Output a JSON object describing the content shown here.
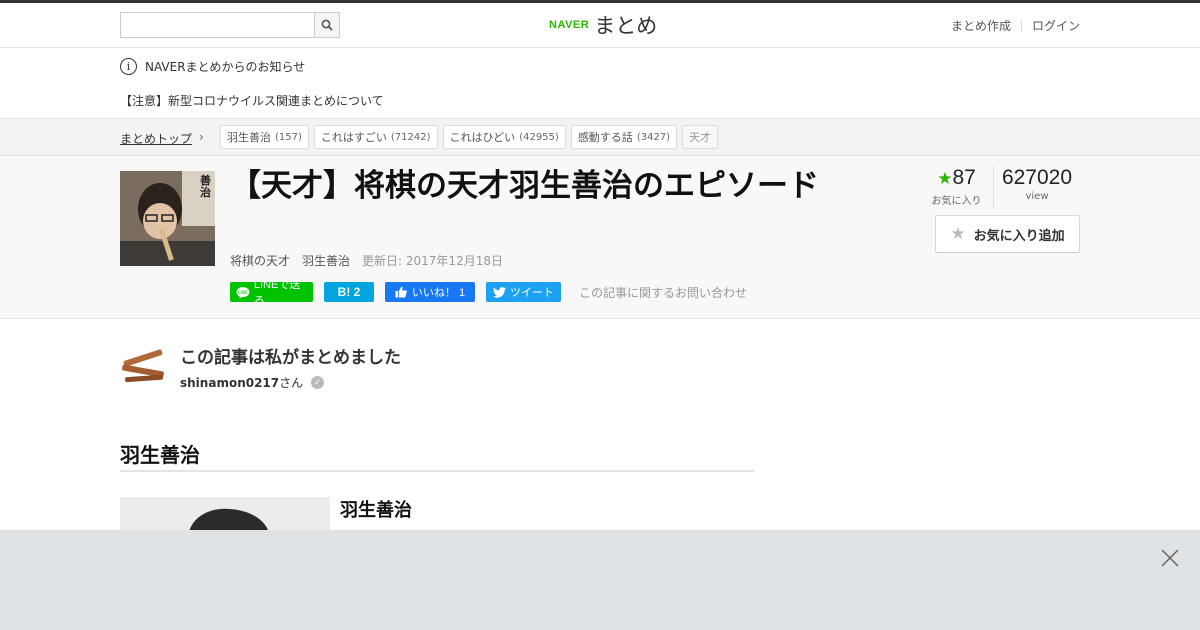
{
  "header": {
    "search_placeholder": "",
    "logo_brand": "NAVER",
    "logo_title": "まとめ",
    "links": [
      "まとめ作成",
      "ログイン"
    ]
  },
  "notice": {
    "title": "NAVERまとめからのお知らせ",
    "link": "【注意】新型コロナウイルス関連まとめについて"
  },
  "breadcrumb": {
    "top": "まとめトップ",
    "tags": [
      {
        "label": "羽生善治",
        "count": "(157)"
      },
      {
        "label": "これはすごい",
        "count": "(71242)"
      },
      {
        "label": "これはひどい",
        "count": "(42955)"
      },
      {
        "label": "感動する話",
        "count": "(3427)"
      },
      {
        "label": "天才",
        "count": ""
      }
    ]
  },
  "article": {
    "title": "【天才】将棋の天才羽生善治のエピソード",
    "tag1": "将棋の天才",
    "tag2": "羽生善治",
    "updated": "更新日: 2017年12月18日",
    "share_line": "LINEで送る",
    "share_hatena": "B! 2",
    "share_like": "いいね！ 1",
    "share_tweet": "ツイート",
    "contact": "この記事に関するお問い合わせ",
    "favorites": "87",
    "favorites_label": "お気に入り",
    "views": "627020",
    "views_label": "view",
    "fav_button": "お気に入り追加",
    "thumb_text": "善治"
  },
  "author": {
    "heading": "この記事は私がまとめました",
    "name": "shinamon0217",
    "suffix": "さん"
  },
  "content": {
    "section_heading": "羽生善治",
    "item_title": "羽生善治"
  },
  "colors": {
    "brand_green": "#2db400",
    "line_green": "#00c300",
    "hatena_blue": "#00a4de",
    "facebook_blue": "#1877f2",
    "twitter_blue": "#1da1f2",
    "favorite_star": "#2db400"
  }
}
